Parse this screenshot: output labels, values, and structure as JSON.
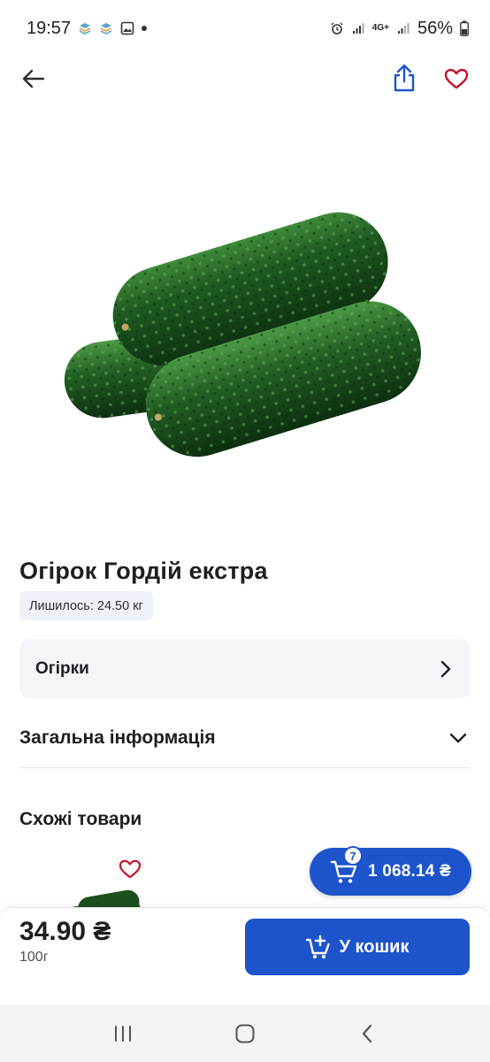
{
  "status_bar": {
    "time": "19:57",
    "network": "4G+",
    "battery": "56%"
  },
  "header": {
    "back_icon": "arrow-left-icon",
    "share_icon": "share-icon",
    "favorite_icon": "heart-outline-icon"
  },
  "product": {
    "title": "Огірок Гордій екстра",
    "stock": "Лишилось: 24.50 кг",
    "category": "Огірки",
    "general_info": "Загальна інформація",
    "price": "34.90 ₴",
    "unit": "100г"
  },
  "similar": {
    "title": "Схожі товари"
  },
  "cart": {
    "count": "7",
    "total": "1 068.14 ₴"
  },
  "actions": {
    "add_to_cart": "У кошик"
  },
  "colors": {
    "accent": "#1d54cc",
    "favorite": "#c8102e"
  }
}
